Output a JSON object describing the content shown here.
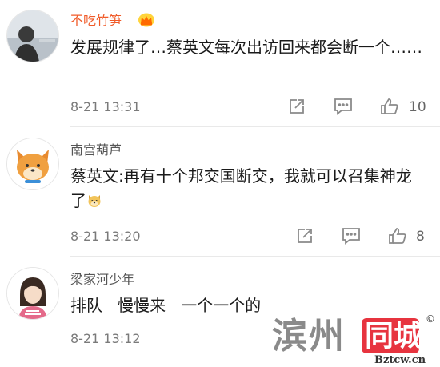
{
  "comments": [
    {
      "username": "不吃竹笋",
      "text": "发展规律了…蔡英文每次出访回来都会断一个……",
      "time": "8-21 13:31",
      "likes": "10"
    },
    {
      "username": "南宫葫芦",
      "text": "蔡英文:再有十个邦交国断交，我就可以召集神龙了",
      "time": "8-21 13:20",
      "likes": "8"
    },
    {
      "username": "梁家河少年",
      "text": "排队   慢慢来   一个一个的",
      "time": "8-21 13:12"
    }
  ],
  "watermark": {
    "brand_a": "滨州",
    "brand_b": "同城",
    "domain": "Bztcw.cn",
    "mark": "©"
  },
  "colors": {
    "vip_name": "#f05a28",
    "plain_name": "#555555",
    "time": "#7a7a7a",
    "icon": "#8a8a8a",
    "watermark_red": "#e7343f"
  },
  "icons": [
    "vip-crown-icon",
    "share-icon",
    "comment-icon",
    "thumbs-up-icon",
    "doge-emoji-icon"
  ]
}
